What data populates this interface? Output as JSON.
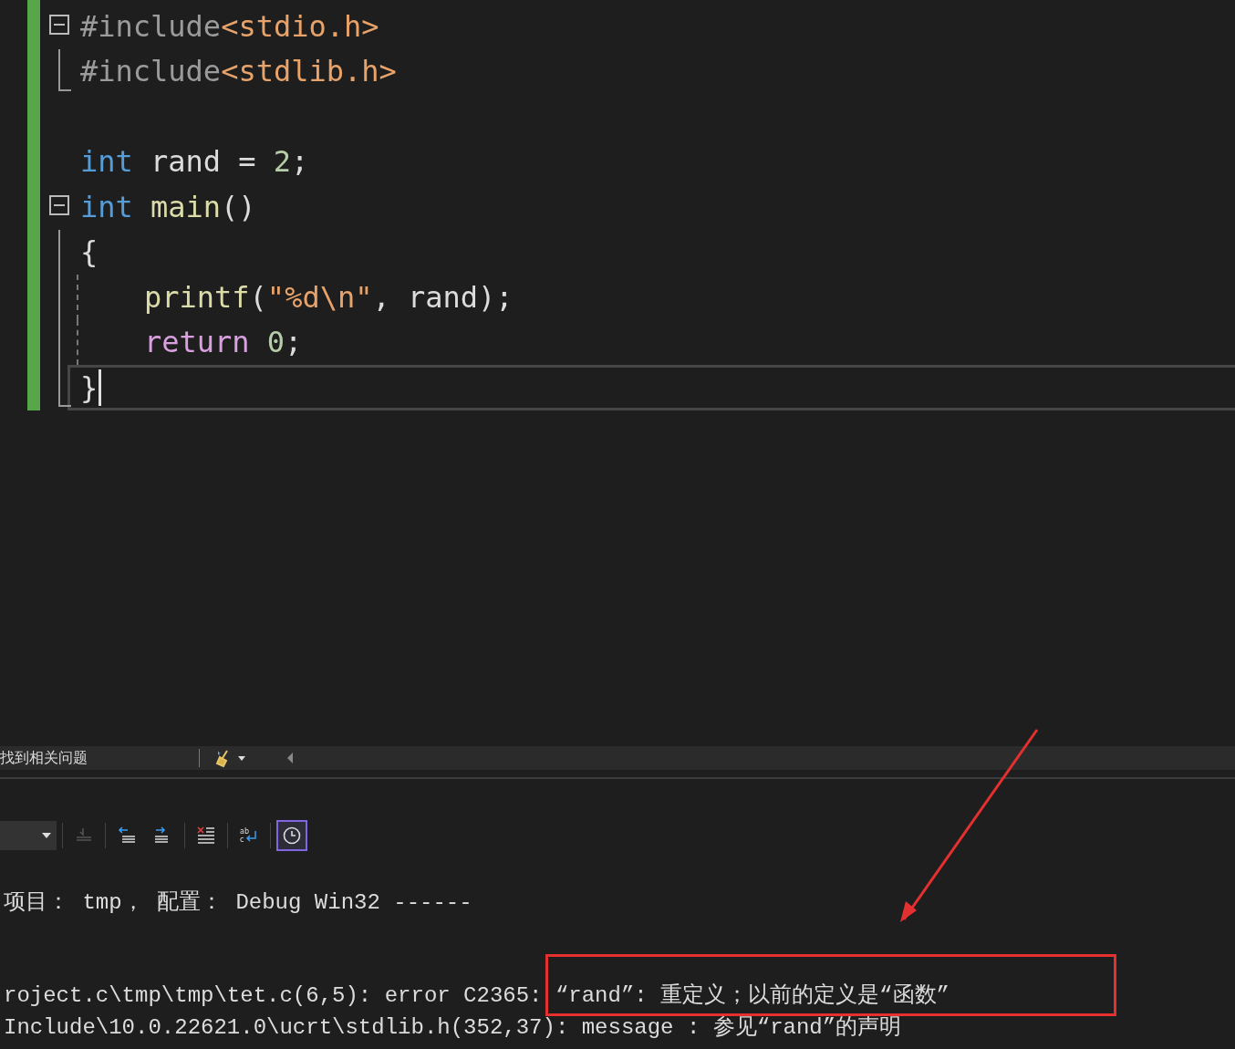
{
  "editor": {
    "lines": [
      {
        "fold_button": true,
        "fold_line": false,
        "fold_end": false,
        "indented": false,
        "current": false,
        "tokens": [
          {
            "kind": "directive",
            "text": "#include",
            "space_before": false
          },
          {
            "kind": "header",
            "text": "<stdio.h>",
            "space_before": false
          }
        ]
      },
      {
        "fold_button": false,
        "fold_line": false,
        "fold_end": true,
        "indented": false,
        "current": false,
        "tokens": [
          {
            "kind": "directive",
            "text": "#include",
            "space_before": false
          },
          {
            "kind": "header",
            "text": "<stdlib.h>",
            "space_before": false
          }
        ]
      },
      {
        "fold_button": false,
        "fold_line": false,
        "fold_end": false,
        "indented": false,
        "current": false
      },
      {
        "fold_button": false,
        "fold_line": false,
        "fold_end": false,
        "indented": false,
        "current": false,
        "tokens": [
          {
            "kind": "keyword",
            "text": "int",
            "space_before": false
          },
          {
            "kind": "plain",
            "text": "rand = ",
            "space_before": true
          },
          {
            "kind": "number",
            "text": "2",
            "space_before": false
          },
          {
            "kind": "plain",
            "text": ";",
            "space_before": false
          }
        ]
      },
      {
        "fold_button": true,
        "fold_line": false,
        "fold_end": false,
        "indented": false,
        "current": false,
        "tokens": [
          {
            "kind": "keyword",
            "text": "int",
            "space_before": false
          },
          {
            "kind": "function",
            "text": "main",
            "space_before": true
          },
          {
            "kind": "plain",
            "text": "()",
            "space_before": false
          }
        ]
      },
      {
        "fold_button": false,
        "fold_line": true,
        "fold_end": false,
        "indented": false,
        "current": false,
        "tokens": [
          {
            "kind": "plain",
            "text": "{",
            "space_before": false
          }
        ]
      },
      {
        "fold_button": false,
        "fold_line": true,
        "fold_end": false,
        "indented": true,
        "current": false,
        "tokens": [
          {
            "kind": "function",
            "text": "printf",
            "space_before": false
          },
          {
            "kind": "plain",
            "text": "(",
            "space_before": false
          },
          {
            "kind": "string",
            "text": "\"%d\\n\"",
            "space_before": false
          },
          {
            "kind": "plain",
            "text": ", rand);",
            "space_before": false
          }
        ]
      },
      {
        "fold_button": false,
        "fold_line": true,
        "fold_end": false,
        "indented": true,
        "current": false,
        "tokens": [
          {
            "kind": "control",
            "text": "return",
            "space_before": false
          },
          {
            "kind": "number",
            "text": "0",
            "space_before": true
          },
          {
            "kind": "plain",
            "text": ";",
            "space_before": false
          }
        ]
      },
      {
        "fold_button": false,
        "fold_line": false,
        "fold_end": true,
        "indented": false,
        "current": true,
        "tokens": [
          {
            "kind": "plain",
            "text": "}",
            "space_before": false
          }
        ]
      }
    ]
  },
  "error_list_bar": {
    "status": "找到相关问题"
  },
  "output": {
    "toolbar": [
      {
        "kind": "dropdown",
        "disabled": false,
        "selected": false
      },
      {
        "kind": "goto",
        "disabled": true,
        "selected": false
      },
      {
        "kind": "prev",
        "disabled": false,
        "selected": false
      },
      {
        "kind": "next",
        "disabled": false,
        "selected": false
      },
      {
        "kind": "clear",
        "disabled": false,
        "selected": false
      },
      {
        "kind": "wrap",
        "disabled": false,
        "selected": false,
        "glyphs": [
          "ab",
          "c"
        ]
      },
      {
        "kind": "clock",
        "disabled": false,
        "selected": true
      }
    ],
    "lines": [
      {
        "text": "项目： tmp， 配置： Debug Win32 ------",
        "blank_before": false
      },
      {
        "text": "roject.c\\tmp\\tmp\\tet.c(6,5): error C2365: “rand”: 重定义；以前的定义是“函数”",
        "blank_before": true
      },
      {
        "text": "Include\\10.0.22621.0\\ucrt\\stdlib.h(352,37): message : 参见“rand”的声明",
        "blank_before": false
      }
    ]
  }
}
